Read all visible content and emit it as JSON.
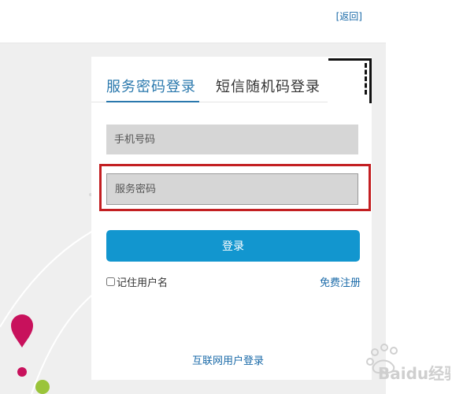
{
  "header": {
    "back_label": "[返回]"
  },
  "tabs": {
    "service_password": "服务密码登录",
    "sms_code": "短信随机码登录"
  },
  "form": {
    "phone_placeholder": "手机号码",
    "password_placeholder": "服务密码",
    "login_label": "登录",
    "remember_label": "记住用户名",
    "register_label": "免费注册",
    "internet_login_label": "互联网用户登录"
  },
  "watermark": {
    "text": "Baidu经验"
  },
  "colors": {
    "accent": "#2a78ad",
    "button": "#1296cf",
    "highlight": "#c31f22",
    "pin": "#c8115c",
    "dot_green": "#9ac43a"
  }
}
